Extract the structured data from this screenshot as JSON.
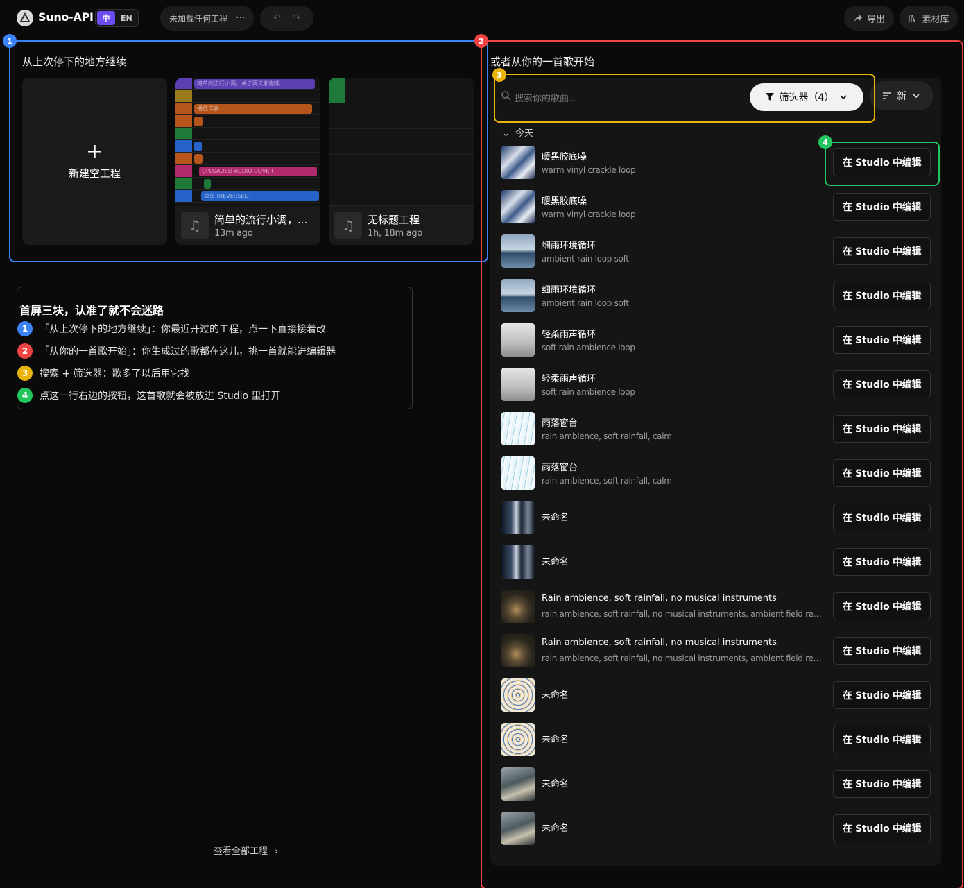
{
  "header": {
    "brand": "Suno-API",
    "lang_zh": "中",
    "lang_en": "EN",
    "project_status": "未加载任何工程",
    "more": "···",
    "undo": "↶",
    "redo": "↷",
    "export": "导出",
    "library": "素材库"
  },
  "badges": {
    "one": "1",
    "two": "2",
    "three": "3",
    "four": "4"
  },
  "continue": {
    "title": "从上次停下的地方继续",
    "new_label": "新建空工程",
    "plus": "+",
    "projects": [
      {
        "title": "简单的流行小调，...",
        "time": "13m ago",
        "clips": [
          "简单的流行小调，关于雨天和咖啡",
          "播放伴奏",
          "UPLOADED AUDIO COVER",
          "简单 [REVERSED]"
        ]
      },
      {
        "title": "无标题工程",
        "time": "1h, 18m ago"
      }
    ],
    "view_all": "查看全部工程"
  },
  "help": {
    "heading": "首屏三块，认准了就不会迷路",
    "items": [
      "「从上次停下的地方继续」：你最近开过的工程，点一下直接接着改",
      "「从你的一首歌开始」：你生成过的歌都在这儿，挑一首就能进编辑器",
      "搜索 + 筛选器：歌多了以后用它找",
      "点这一行右边的按钮，这首歌就会被放进 Studio 里打开"
    ]
  },
  "songs_section": {
    "title": "或者从你的一首歌开始",
    "search_placeholder": "搜索你的歌曲...",
    "filter_label": "筛选器（4）",
    "sort_label": "新",
    "group": "今天",
    "edit_label": "在 Studio 中编辑",
    "songs": [
      {
        "title": "暖黑胶底噪",
        "subtitle": "warm vinyl crackle loop",
        "thumb": "building"
      },
      {
        "title": "暖黑胶底噪",
        "subtitle": "warm vinyl crackle loop",
        "thumb": "building"
      },
      {
        "title": "细雨环境循环",
        "subtitle": "ambient rain loop soft",
        "thumb": "lake"
      },
      {
        "title": "细雨环境循环",
        "subtitle": "ambient rain loop soft",
        "thumb": "lake"
      },
      {
        "title": "轻柔雨声循环",
        "subtitle": "soft rain ambience loop",
        "thumb": "pole"
      },
      {
        "title": "轻柔雨声循环",
        "subtitle": "soft rain ambience loop",
        "thumb": "pole"
      },
      {
        "title": "雨落窗台",
        "subtitle": "rain ambience, soft rainfall, calm",
        "thumb": "rain"
      },
      {
        "title": "雨落窗台",
        "subtitle": "rain ambience, soft rainfall, calm",
        "thumb": "rain"
      },
      {
        "title": "未命名",
        "subtitle": "",
        "thumb": "city"
      },
      {
        "title": "未命名",
        "subtitle": "",
        "thumb": "city"
      },
      {
        "title": "Rain ambience, soft rainfall, no musical instruments",
        "subtitle": "rain ambience, soft rainfall, no musical instruments, ambient field recording, cal...",
        "thumb": "still"
      },
      {
        "title": "Rain ambience, soft rainfall, no musical instruments",
        "subtitle": "rain ambience, soft rainfall, no musical instruments, ambient field recording, cal...",
        "thumb": "still"
      },
      {
        "title": "未命名",
        "subtitle": "",
        "thumb": "swirl"
      },
      {
        "title": "未命名",
        "subtitle": "",
        "thumb": "swirl"
      },
      {
        "title": "未命名",
        "subtitle": "",
        "thumb": "room"
      },
      {
        "title": "未命名",
        "subtitle": "",
        "thumb": "room"
      }
    ]
  },
  "colors": {
    "blue": "#3b82f6",
    "red": "#ef4444",
    "yellow": "#eab308",
    "green": "#22c55e",
    "accent": "#6d4df2"
  }
}
